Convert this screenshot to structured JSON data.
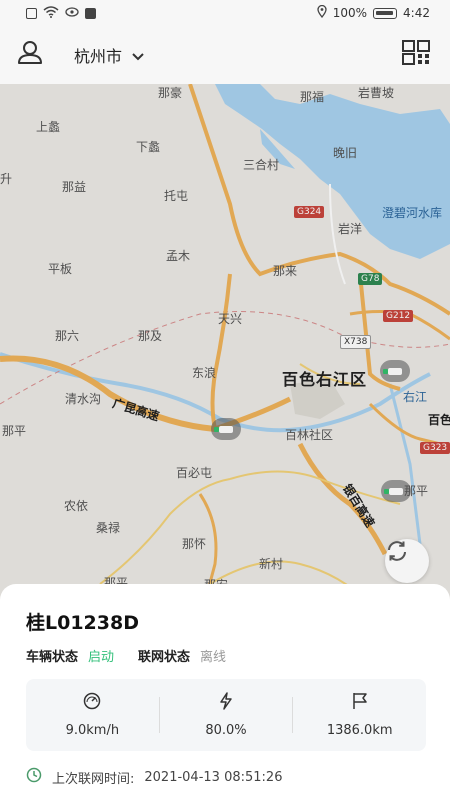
{
  "status_bar": {
    "battery": "100%",
    "time": "4:42"
  },
  "header": {
    "city": "杭州市"
  },
  "map": {
    "places": [
      "上蠡",
      "下蠡",
      "那豪",
      "那福",
      "岩曹坡",
      "晚旧",
      "三合村",
      "托屯",
      "那益",
      "升",
      "岩洋",
      "澄碧河水库",
      "孟木",
      "平板",
      "那来",
      "那六",
      "那及",
      "天兴",
      "东浪",
      "百色右江区",
      "清水沟",
      "右江",
      "百色",
      "百林社区",
      "那平",
      "百必屯",
      "那平",
      "农依",
      "桑禄",
      "那怀",
      "新村",
      "那平",
      "那安"
    ],
    "highways": [
      "广昆高速",
      "银百高速"
    ],
    "shields": [
      "G324",
      "G78",
      "G212",
      "X738",
      "G323"
    ]
  },
  "vehicle": {
    "plate": "桂L01238D",
    "status_label": "车辆状态",
    "status_value": "启动",
    "network_label": "联网状态",
    "network_value": "离线",
    "speed": "9.0km/h",
    "battery": "80.0%",
    "mileage": "1386.0km",
    "last_online_label": "上次联网时间:",
    "last_online_time": "2021-04-13 08:51:26"
  },
  "colors": {
    "accent_green": "#34c07b",
    "offline_gray": "#999999",
    "water": "#a9d3f1",
    "road": "#f0b35a"
  }
}
